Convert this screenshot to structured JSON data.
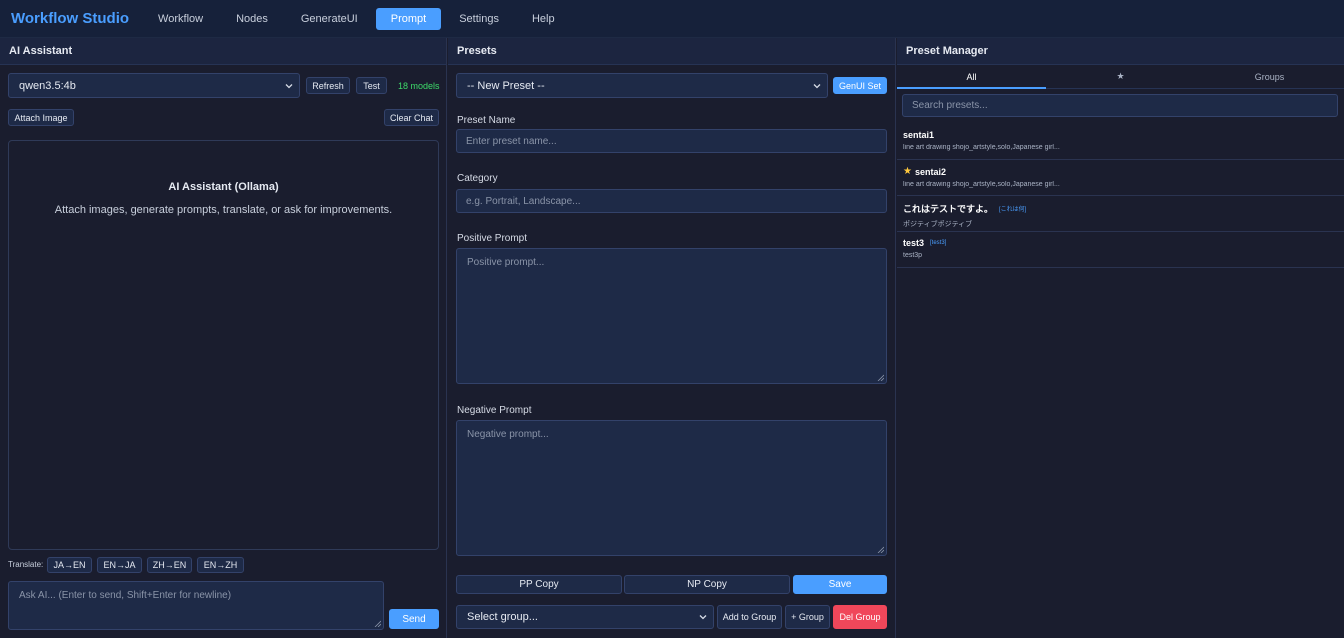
{
  "nav": {
    "brand": "Workflow Studio",
    "items": [
      "Workflow",
      "Nodes",
      "GenerateUI",
      "Prompt",
      "Settings",
      "Help"
    ],
    "active": "Prompt"
  },
  "assistant": {
    "header": "AI Assistant",
    "model": "qwen3.5:4b",
    "refresh": "Refresh",
    "test": "Test",
    "model_count": "18 models",
    "attach": "Attach Image",
    "clear": "Clear Chat",
    "chat_title": "AI Assistant (Ollama)",
    "chat_sub": "Attach images, generate prompts, translate, or ask for improvements.",
    "translate_label": "Translate:",
    "translate": [
      "JA→EN",
      "EN→JA",
      "ZH→EN",
      "EN→ZH"
    ],
    "ask_placeholder": "Ask AI... (Enter to send, Shift+Enter for newline)",
    "send": "Send"
  },
  "presets": {
    "header": "Presets",
    "selected": "-- New Preset --",
    "genui": "GenUI Set",
    "name_label": "Preset Name",
    "name_placeholder": "Enter preset name...",
    "category_label": "Category",
    "category_placeholder": "e.g. Portrait, Landscape...",
    "positive_label": "Positive Prompt",
    "positive_placeholder": "Positive prompt...",
    "negative_label": "Negative Prompt",
    "negative_placeholder": "Negative prompt...",
    "pp_copy": "PP Copy",
    "np_copy": "NP Copy",
    "save": "Save",
    "group_select": "Select group...",
    "add_to_group": "Add to Group",
    "plus_group": "+ Group",
    "del_group": "Del Group"
  },
  "manager": {
    "header": "Preset Manager",
    "tabs": [
      "All",
      "★",
      "Groups"
    ],
    "search_placeholder": "Search presets...",
    "items": [
      {
        "name": "sentai1",
        "desc": "line art drawing shojo_artstyle,solo,Japanese girl...",
        "group": "",
        "fav": false
      },
      {
        "name": "sentai2",
        "desc": "line art drawing shojo_artstyle,solo,Japanese girl...",
        "group": "",
        "fav": true
      },
      {
        "name": "これはテストですよ。",
        "desc": "ポジティブポジティブ",
        "group": "[これは何]",
        "fav": false
      },
      {
        "name": "test3",
        "desc": "test3p",
        "group": "[test3]",
        "fav": false
      }
    ]
  },
  "colors": {
    "accent": "#4a9eff",
    "danger": "#f0475a",
    "success": "#3ddc6a",
    "star": "#ffc83d"
  }
}
